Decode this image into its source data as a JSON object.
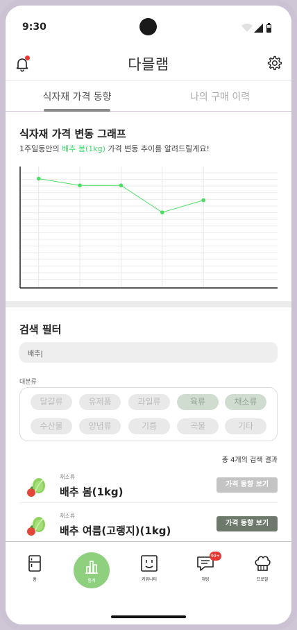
{
  "status_bar": {
    "time": "9:30"
  },
  "app": {
    "title": "다믈램"
  },
  "tabs": [
    {
      "label": "식자재 가격 동향",
      "active": true
    },
    {
      "label": "나의 구매 이력",
      "active": false
    }
  ],
  "graph_section": {
    "title": "식자재 가격 변동 그래프",
    "subtitle_prefix": "1주일동안의 ",
    "subtitle_highlight": "배추 봄(1kg)",
    "subtitle_suffix": " 가격 변동 추이를 알려드릴게요!"
  },
  "chart_data": {
    "type": "line",
    "title": "",
    "xlabel": "",
    "ylabel": "",
    "x": [
      1,
      2,
      3,
      4,
      5
    ],
    "series": [
      {
        "values": [
          8.1,
          7.6,
          7.6,
          5.6,
          6.5
        ]
      }
    ],
    "ylim": [
      0,
      9
    ],
    "grid": true,
    "color": "#4ade63"
  },
  "filter": {
    "title": "검색 필터",
    "search_value": "배추|",
    "category_label": "대분류",
    "categories": [
      {
        "label": "달걀류",
        "selected": false
      },
      {
        "label": "유제품",
        "selected": false
      },
      {
        "label": "과일류",
        "selected": false
      },
      {
        "label": "육류",
        "selected": true
      },
      {
        "label": "채소류",
        "selected": true
      },
      {
        "label": "수산물",
        "selected": false
      },
      {
        "label": "양념류",
        "selected": false
      },
      {
        "label": "기름",
        "selected": false
      },
      {
        "label": "곡물",
        "selected": false
      },
      {
        "label": "기타",
        "selected": false
      }
    ]
  },
  "results": {
    "count_text": "총 4개의 검색 결과",
    "items": [
      {
        "category": "채소류",
        "name": "배추 봄(1kg)",
        "button": "가격 동향 보기",
        "button_style": "light"
      },
      {
        "category": "채소류",
        "name": "배추 여름(고랭지)(1kg)",
        "button": "가격 동향 보기",
        "button_style": "dark"
      }
    ]
  },
  "bottom_nav": [
    {
      "label": "홈",
      "icon": "fridge-icon"
    },
    {
      "label": "통계",
      "icon": "bar-chart-icon",
      "active": true
    },
    {
      "label": "커뮤니티",
      "icon": "smiley-board-icon"
    },
    {
      "label": "채팅",
      "icon": "chat-bubble-icon",
      "badge": "99+"
    },
    {
      "label": "프로필",
      "icon": "chef-hat-icon"
    }
  ],
  "colors": {
    "accent_green": "#8fd07f",
    "highlight_green": "#3ddc6a",
    "badge_red": "#e53935",
    "dark_button": "#6d7a6b"
  }
}
